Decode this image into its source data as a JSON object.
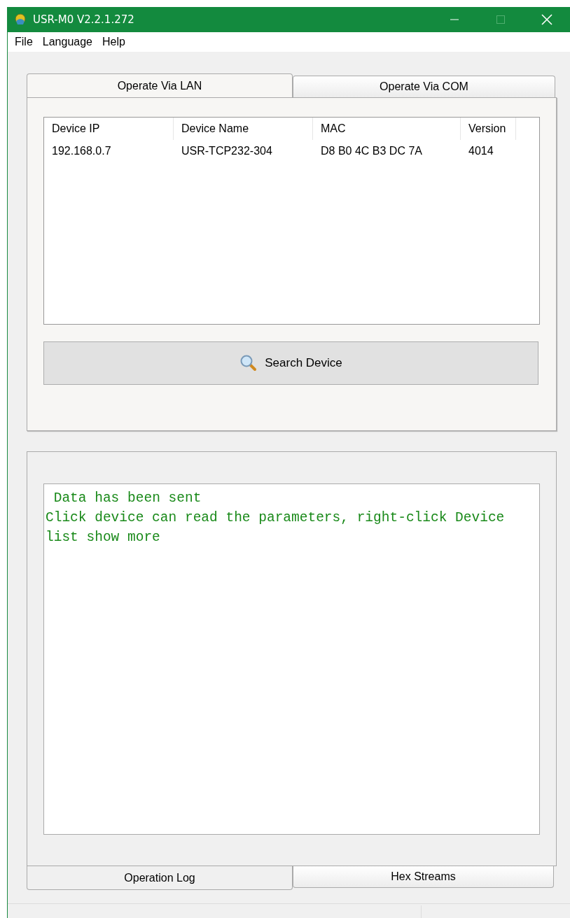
{
  "window": {
    "title": "USR-M0 V2.2.1.272"
  },
  "menu": [
    "File",
    "Language",
    "Help"
  ],
  "top_tabs": [
    {
      "label": "Operate Via LAN",
      "selected": true
    },
    {
      "label": "Operate Via COM",
      "selected": false
    }
  ],
  "device_table": {
    "columns": [
      "Device IP",
      "Device Name",
      "MAC",
      "Version"
    ],
    "rows": [
      [
        "192.168.0.7",
        "USR-TCP232-304",
        "D8 B0 4C B3 DC 7A",
        "4014"
      ]
    ]
  },
  "search_button": "Search Device",
  "log_lines": [
    " Data has been sent",
    "Click device can read the parameters, right-click Device list show more"
  ],
  "bottom_tabs": [
    {
      "label": "Operation Log",
      "selected": true
    },
    {
      "label": "Hex Streams",
      "selected": false
    }
  ]
}
